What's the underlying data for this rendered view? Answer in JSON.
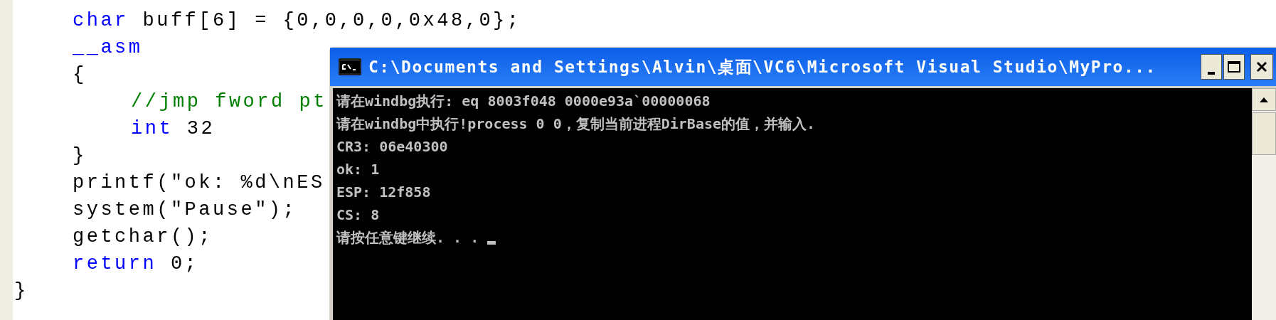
{
  "code": [
    {
      "children": [
        {
          "tokens": [
            {
              "kind": "keyword",
              "text": "char"
            },
            {
              "kind": "plain",
              "text": " buff[6] = {0,0,0,0,0x48,0};"
            }
          ]
        },
        {
          "tokens": [
            {
              "kind": "keyword",
              "text": "__asm"
            }
          ]
        },
        {
          "tokens": [
            {
              "kind": "plain",
              "text": "{"
            }
          ]
        },
        {
          "children": [
            {
              "tokens": [
                {
                  "kind": "comment",
                  "text": "//jmp fword pt"
                }
              ]
            },
            {
              "tokens": [
                {
                  "kind": "keyword",
                  "text": "int"
                },
                {
                  "kind": "plain",
                  "text": " 32"
                }
              ]
            }
          ]
        },
        {
          "tokens": [
            {
              "kind": "plain",
              "text": "}"
            }
          ]
        },
        {
          "tokens": [
            {
              "kind": "plain",
              "text": "printf(\"ok: %d\\nES"
            }
          ]
        },
        {
          "tokens": [
            {
              "kind": "plain",
              "text": "system(\"Pause\");"
            }
          ]
        },
        {
          "tokens": [
            {
              "kind": "plain",
              "text": "getchar();"
            }
          ]
        },
        {
          "tokens": [
            {
              "kind": "keyword",
              "text": "return"
            },
            {
              "kind": "plain",
              "text": " 0;"
            }
          ]
        }
      ]
    },
    {
      "tokens": [
        {
          "kind": "plain",
          "text": "}"
        }
      ]
    }
  ],
  "console": {
    "title": "C:\\Documents and Settings\\Alvin\\桌面\\VC6\\Microsoft Visual Studio\\MyPro...",
    "lines": [
      "请在windbg执行: eq 8003f048 0000e93a`00000068",
      "请在windbg中执行!process 0 0，复制当前进程DirBase的值，并输入.",
      "CR3: 06e40300",
      "ok: 1",
      "ESP: 12f858",
      "CS: 8",
      "请按任意键继续. . . "
    ],
    "cursor": true
  }
}
